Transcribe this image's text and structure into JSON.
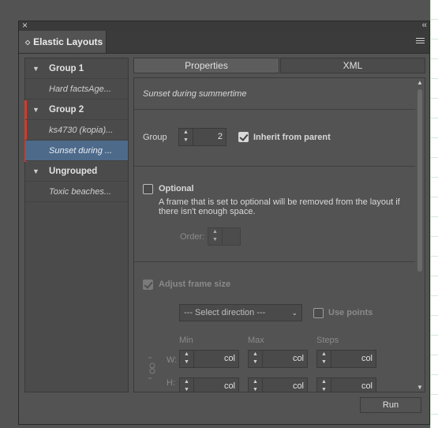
{
  "window": {
    "close_glyph": "×",
    "collapse_glyph": "‹‹",
    "tab_title": "Elastic Layouts",
    "tab_updown_glyph": "◇"
  },
  "sidebar": {
    "groups": [
      {
        "label": "Group 1",
        "items": [
          "Hard factsAge..."
        ]
      },
      {
        "label": "Group 2",
        "items": [
          "ks4730 (kopia)...",
          "Sunset during ..."
        ]
      },
      {
        "label": "Ungrouped",
        "items": [
          "Toxic beaches..."
        ]
      }
    ],
    "selected_item": "Sunset during ..."
  },
  "tabs": {
    "properties": "Properties",
    "xml": "XML"
  },
  "properties": {
    "frame_name": "Sunset during summertime",
    "group_label": "Group",
    "group_value": "2",
    "inherit_label": "Inherit from parent",
    "inherit_checked": true,
    "optional_label": "Optional",
    "optional_checked": false,
    "optional_description_line1": "A frame that is set to optional will be removed from the layout if",
    "optional_description_line2": "there isn't enough space.",
    "order_label": "Order:",
    "adjust_label": "Adjust frame size",
    "adjust_checked": true,
    "direction_placeholder": "--- Select direction ---",
    "use_points_label": "Use points",
    "use_points_checked": false,
    "col_min": "Min",
    "col_max": "Max",
    "col_steps": "Steps",
    "row_w": "W:",
    "row_h": "H:",
    "unit": "col"
  },
  "footer": {
    "run_label": "Run"
  }
}
